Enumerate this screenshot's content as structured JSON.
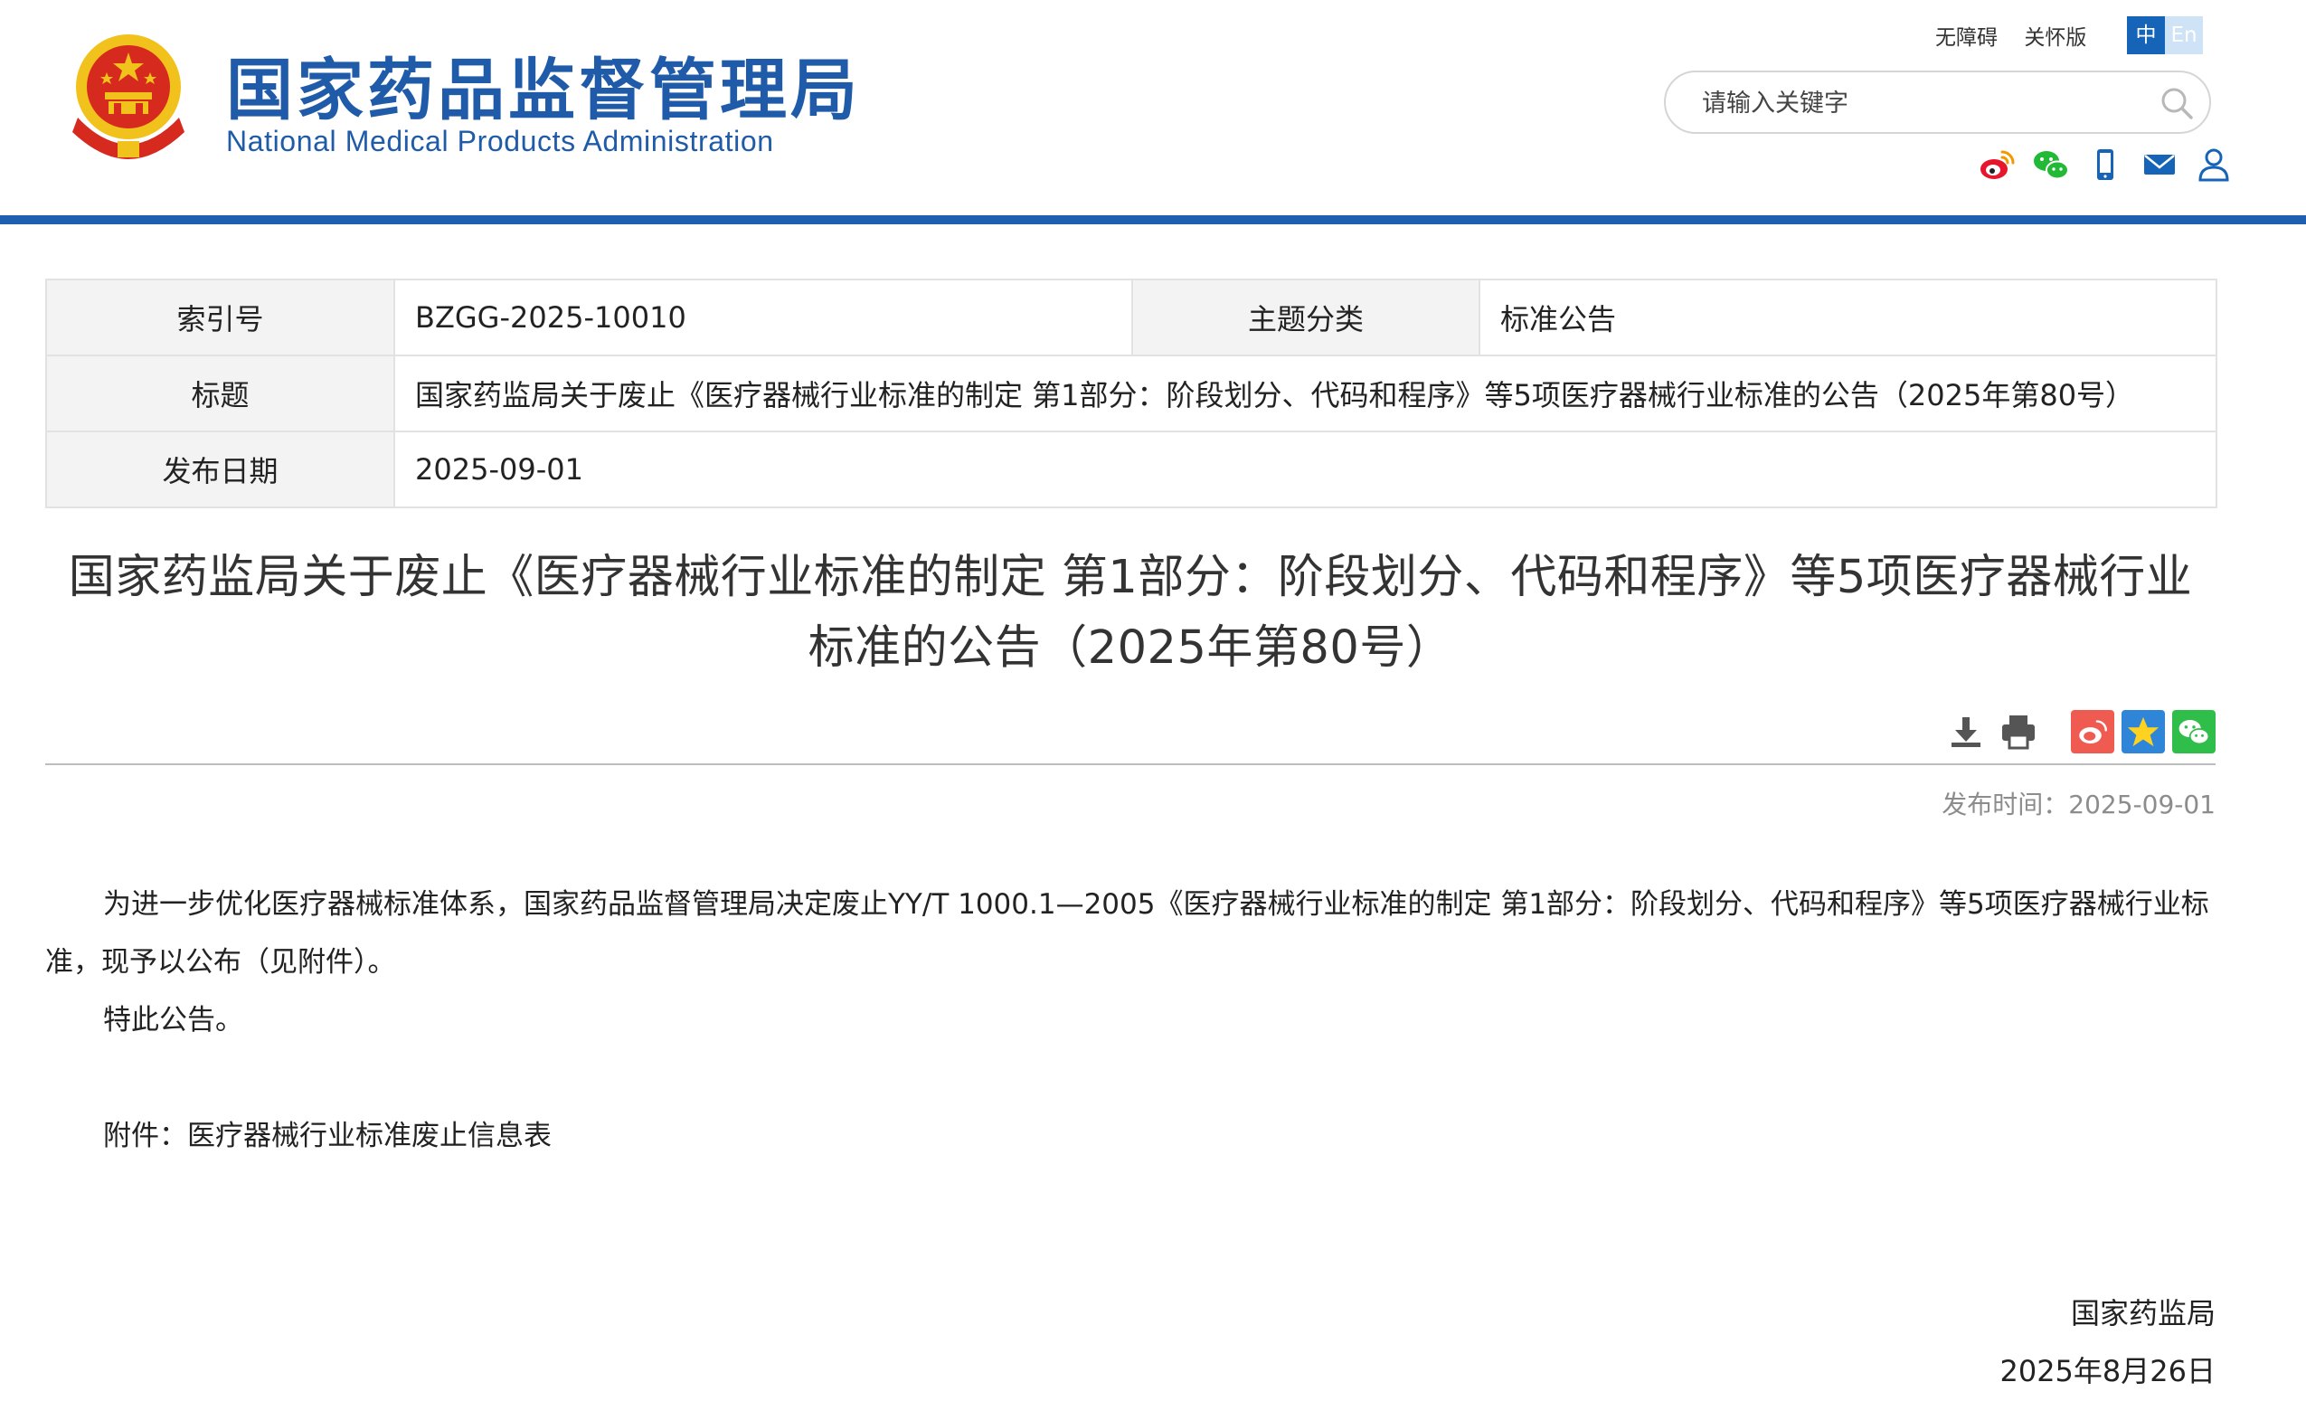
{
  "colors": {
    "brand_blue": "#1e5fb0",
    "logo_blue": "#1f5ba8",
    "emblem_red": "#d62a1f",
    "emblem_gold": "#f2c21c",
    "weibo_red": "#e6162d",
    "wechat_green": "#21b936"
  },
  "header": {
    "logo_cn": "国家药品监督管理局",
    "logo_en": "National Medical Products Administration",
    "links": {
      "accessibility": "无障碍",
      "care_mode": "关怀版"
    },
    "lang": {
      "zh": "中",
      "en": "En"
    },
    "search": {
      "placeholder": "请输入关键字"
    },
    "social_icons": [
      "weibo-icon",
      "wechat-icon",
      "mobile-icon",
      "mail-icon",
      "user-icon"
    ]
  },
  "meta": {
    "index_label": "索引号",
    "index_value": "BZGG-2025-10010",
    "topic_label": "主题分类",
    "topic_value": "标准公告",
    "title_label": "标题",
    "title_value": "国家药监局关于废止《医疗器械行业标准的制定 第1部分：阶段划分、代码和程序》等5项医疗器械行业标准的公告（2025年第80号）",
    "date_label": "发布日期",
    "date_value": "2025-09-01"
  },
  "article": {
    "title_line1": "国家药监局关于废止《医疗器械行业标准的制定 第1部分：阶段划分、代码和程序》等5项医疗器械行业",
    "title_line2": "标准的公告（2025年第80号）",
    "publish_time": "发布时间：2025-09-01",
    "tool_icons": [
      "download-icon",
      "print-icon",
      "weibo-share-icon",
      "favorite-icon",
      "wechat-share-icon"
    ],
    "paragraph1": "为进一步优化医疗器械标准体系，国家药品监督管理局决定废止YY/T 1000.1—2005《医疗器械行业标准的制定 第1部分：阶段划分、代码和程序》等5项医疗器械行业标准，现予以公布（见附件）。",
    "paragraph2": "特此公告。",
    "attachment": "附件：医疗器械行业标准废止信息表",
    "signature_org": "国家药监局",
    "signature_date": "2025年8月26日"
  }
}
